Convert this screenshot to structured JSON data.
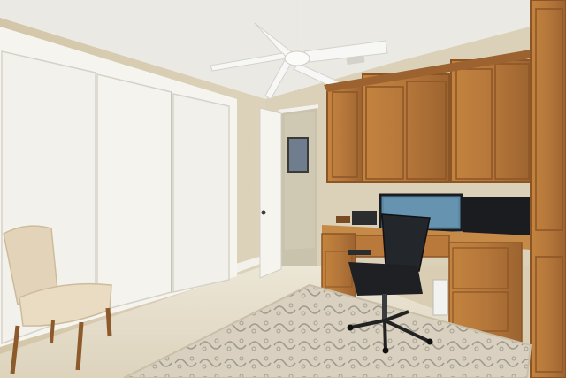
{
  "photo": {
    "scene": "home-office-room",
    "colors": {
      "wall": "#d9cfb4",
      "ceiling": "#eceae4",
      "cabinet_wood": "#b87a3c",
      "cabinet_dark": "#8c5526",
      "closet_door": "#f4f2ee",
      "floor_tile": "#e4dcc8",
      "rug": "#d8cfbd",
      "rug_pattern": "#9c9a8e",
      "chair_fabric": "#e2d3b8",
      "office_chair": "#1f2226",
      "monitor": "#1a1c20"
    }
  }
}
